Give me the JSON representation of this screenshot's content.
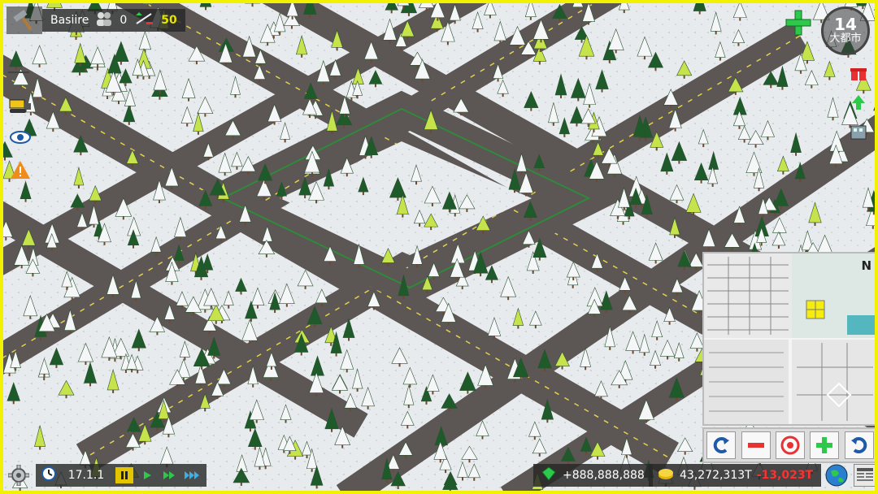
{
  "hud": {
    "city_name": "Basiire",
    "population": "0",
    "money_small": "50",
    "city_level": "14",
    "city_rank": "大都市"
  },
  "bottom": {
    "date": "17.1.1",
    "diamonds": "+888,888,888",
    "coins": "43,272,313T",
    "income": "-13,023T"
  },
  "minimap": {
    "north_label": "N"
  },
  "icons": {
    "build": "hammer-icon",
    "population": "people-icon",
    "budget": "budget-icon",
    "bulldozer": "bulldozer-icon",
    "view": "eye-icon",
    "warning": "warning-icon",
    "add": "plus-icon",
    "gift": "gift-icon",
    "settings": "gear-icon",
    "clock": "clock-icon",
    "globe": "globe-icon",
    "newspaper": "newspaper-icon"
  },
  "colors": {
    "frame": "#f2f200",
    "road": "#5f5a58",
    "snow": "#eceff2",
    "tree_dark": "#1f5a2a",
    "tree_light": "#c7e34b",
    "money_yellow": "#e4e400",
    "negative": "#ff3030"
  }
}
